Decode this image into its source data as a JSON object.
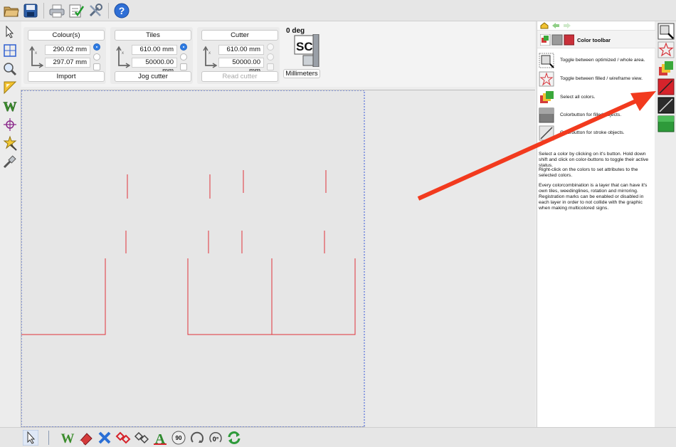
{
  "toolbar_top": {
    "buttons": [
      "open-icon",
      "save-icon",
      "print-icon",
      "checklist-icon",
      "tools-icon",
      "help-icon"
    ]
  },
  "left_tools": [
    "select-arrow-icon",
    "frame-select-icon",
    "zoom-icon",
    "ruler-icon",
    "weed-icon",
    "crosshair-icon",
    "star-magic-icon",
    "knife-icon"
  ],
  "settings": {
    "colours": {
      "header": "Colour(s)",
      "width": "290.02 mm",
      "height": "297.07 mm",
      "footer": "Import"
    },
    "tiles": {
      "header": "Tiles",
      "width": "610.00 mm",
      "height": "50000.00 mm",
      "footer": "Jog cutter"
    },
    "cutter": {
      "header": "Cutter",
      "width": "610.00 mm",
      "height": "50000.00 mm",
      "footer": "Read cutter"
    },
    "rotation": "0 deg",
    "units": "Millimeters",
    "logo_text": "SC"
  },
  "help": {
    "title": "Color toolbar",
    "rows": [
      {
        "text": "Toggle between optimized / whole area."
      },
      {
        "text": "Toggle between filled / wireframe view."
      },
      {
        "text": "Select all colors."
      },
      {
        "text": "Colorbutton for filled objects."
      },
      {
        "text": "Colorbutton for stroke objects."
      }
    ],
    "paragraphs": [
      "Select a color by clicking on it's button. Hold down shift and click on color-buttons to toggle their active status.",
      "Right-click on the colors to set attributes to the selected colors.",
      "Every colorcombination is a layer that can have it's own tiles, weedinglines, rotation and mirroring. Registration marks can be enabled or disabled in each layer in order to not collide with the graphic when making multicolored signs."
    ]
  },
  "right_tools": [
    "optimized-area-icon",
    "filled-wireframe-icon",
    "select-all-colors-icon",
    "red-stroke-color-icon",
    "black-stroke-color-icon",
    "green-fill-color-icon"
  ],
  "bottom_tools": {
    "rotate_90_label": "90",
    "rotate_0_label": "0°"
  },
  "colors": {
    "accent": "#2f7ce3",
    "cut_line": "#e0313a",
    "page_border": "#3b5bdb",
    "annotation": "#f23a1e"
  }
}
